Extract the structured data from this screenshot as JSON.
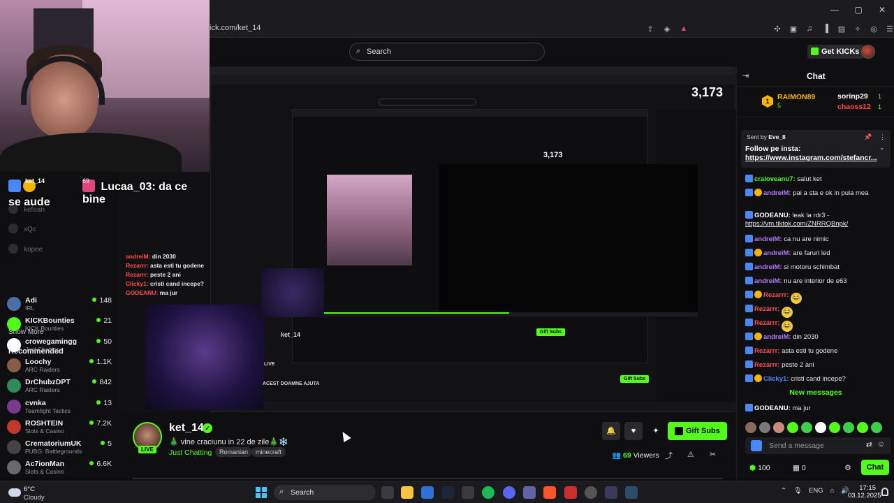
{
  "browser": {
    "url": "ick.com/ket_14",
    "window_controls": [
      "—",
      "▢",
      "✕"
    ]
  },
  "header": {
    "search_placeholder": "Search",
    "get_kicks_label": "Get KICKs",
    "accent": "#53fc18"
  },
  "sidebar": {
    "show_more": "Show More",
    "recommended_title": "Recommended",
    "followed_faded": [
      "kefean",
      "xQc",
      "kopee"
    ],
    "recommended": [
      {
        "name": "Adi",
        "category": "IRL",
        "viewers": "148"
      },
      {
        "name": "KICKBounties",
        "category": "KICK Bounties",
        "viewers": "21"
      },
      {
        "name": "crowegamingg",
        "category": "Just Chatting",
        "viewers": "50"
      },
      {
        "name": "Loochy",
        "category": "ARC Raiders",
        "viewers": "1.1K"
      },
      {
        "name": "DrChubzDPT",
        "category": "ARC Raiders",
        "viewers": "842"
      },
      {
        "name": "cvnka",
        "category": "Teamfight Tactics",
        "viewers": "13"
      },
      {
        "name": "ROSHTEIN",
        "category": "Slots & Casino",
        "viewers": "7.2K"
      },
      {
        "name": "CrematoriumUK",
        "category": "PUBG: Battlegrounds",
        "viewers": "5"
      },
      {
        "name": "Ac7ionMan",
        "category": "Slots & Casino",
        "viewers": "6.6K"
      }
    ]
  },
  "overlay": {
    "channel_tag": "ket_14",
    "channel_count": "69",
    "chat_user": "Lucaa_03:",
    "chat_text": "da ce bine",
    "chat_text2": "se aude",
    "nested_viewer_count": "3,173",
    "nested_viewer_count_small": "3,173",
    "nested_chat": [
      {
        "user": "andreiM:",
        "text": "din 2030"
      },
      {
        "user": "Rezarrr:",
        "text": "asta esti tu godene"
      },
      {
        "user": "Rezarrr:",
        "text": "peste 2 ani"
      },
      {
        "user": "Clicky1:",
        "text": "cristi cand incepe?"
      },
      {
        "user": "GODEANU:",
        "text": "ma jur"
      }
    ],
    "nested_live_label": "LIVE",
    "nested_gift_label": "Gift Subs",
    "nested_bottom_text": "ACEST DOAMNE AJUTA"
  },
  "stream": {
    "streamer_name": "ket_14",
    "live_label": "LIVE",
    "title": "🎄 vine craciunu in 22 de zile🎄❄️",
    "category": "Just Chatting",
    "tags": [
      "Romanian",
      "minecraft"
    ],
    "viewers_count": "69",
    "viewers_label": "Viewers",
    "gift_subs_label": "Gift Subs"
  },
  "chat": {
    "title": "Chat",
    "leaderboard": [
      {
        "name": "RAIMON89",
        "subs": "5",
        "rank": "1",
        "color": "#f4b400"
      },
      {
        "name": "sorinp29",
        "subs": "1",
        "color": "#ffffff"
      },
      {
        "name": "chaoss12",
        "subs": "1",
        "color": "#ff4d4d"
      }
    ],
    "pinned": {
      "sent_by_prefix": "Sent by",
      "sent_by_user": "Eve_8",
      "line1": "Follow pe insta:",
      "line2": "https://www.instagram.com/stefancr..."
    },
    "messages": [
      {
        "user": "craioveanu7:",
        "text": "salut ket",
        "color": "#53fc18"
      },
      {
        "user": "andreiM:",
        "text": "pai a sta e ok in pula mea",
        "color": "#b57bff"
      },
      {
        "user": "GODEANU:",
        "text": "leak la rdr3 -",
        "link": "https://vm.tiktok.com/ZNRRQBnpk/",
        "color": "#ffffff"
      },
      {
        "user": "andreiM:",
        "text": "ca nu are nimic",
        "color": "#b57bff"
      },
      {
        "user": "andreiM:",
        "text": "are faruri led",
        "color": "#b57bff"
      },
      {
        "user": "andreiM:",
        "text": "si motoru schimbat",
        "color": "#b57bff"
      },
      {
        "user": "andreiM:",
        "text": "nu are interior de e63",
        "color": "#b57bff"
      },
      {
        "user": "Rezarrr:",
        "text": "😂",
        "color": "#ff4d4d"
      },
      {
        "user": "Rezarrr:",
        "text": "😂",
        "color": "#ff4d4d"
      },
      {
        "user": "Rezarrr:",
        "text": "😂",
        "color": "#ff4d4d"
      },
      {
        "user": "andreiM:",
        "text": "din 2030",
        "color": "#b57bff"
      },
      {
        "user": "Rezarrr:",
        "text": "asta esti tu godene",
        "color": "#ff4d4d"
      },
      {
        "user": "Rezarrr:",
        "text": "peste 2 ani",
        "color": "#ff4d4d"
      },
      {
        "user": "Clicky1:",
        "text": "cristi cand incepe?",
        "color": "#4b88ff"
      }
    ],
    "new_messages_label": "New messages",
    "new_message": {
      "user": "GODEANU:",
      "text": "ma jur",
      "color": "#ffffff"
    },
    "input_placeholder": "Send a message",
    "kicks_count": "100",
    "store_count": "0",
    "chat_button": "Chat"
  },
  "taskbar": {
    "temperature": "6°C",
    "condition": "Cloudy",
    "search_placeholder": "Search",
    "language": "ENG",
    "time": "17:15",
    "date": "03.12.2025"
  }
}
